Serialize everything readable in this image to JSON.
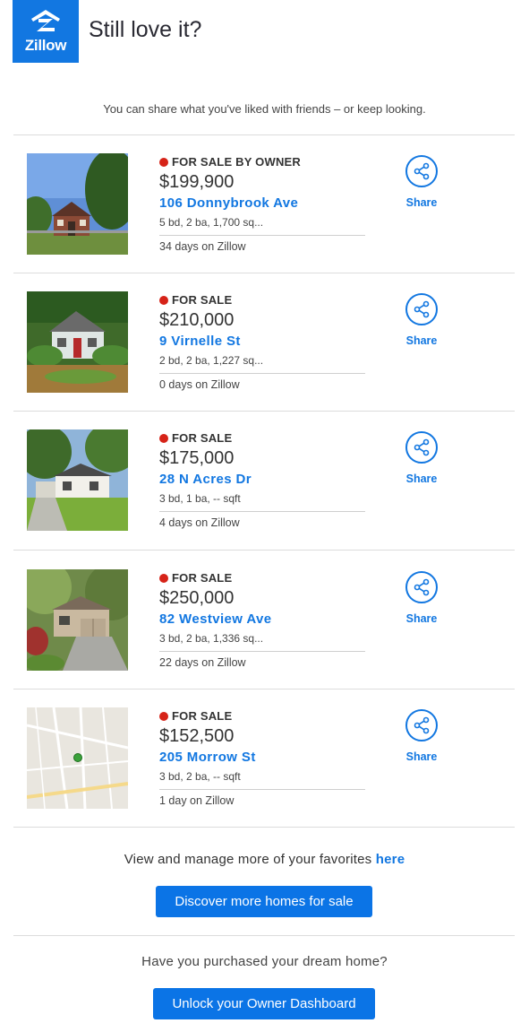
{
  "header": {
    "logo_text": "Zillow",
    "title": "Still love it?"
  },
  "subtitle": "You can share what you've liked with friends – or keep looking.",
  "listings": [
    {
      "status": "FOR SALE BY OWNER",
      "price": "$199,900",
      "address": "106 Donnybrook Ave",
      "facts": "5 bd, 2 ba, 1,700 sq...",
      "days": "34 days on Zillow",
      "share": "Share",
      "photo": "house-brick"
    },
    {
      "status": "FOR SALE",
      "price": "$210,000",
      "address": "9 Virnelle St",
      "facts": "2 bd, 2 ba, 1,227 sq...",
      "days": "0 days on Zillow",
      "share": "Share",
      "photo": "house-green"
    },
    {
      "status": "FOR SALE",
      "price": "$175,000",
      "address": "28 N Acres Dr",
      "facts": "3 bd, 1 ba, -- sqft",
      "days": "4 days on Zillow",
      "share": "Share",
      "photo": "house-white"
    },
    {
      "status": "FOR SALE",
      "price": "$250,000",
      "address": "82 Westview Ave",
      "facts": "3 bd, 2 ba, 1,336 sq...",
      "days": "22 days on Zillow",
      "share": "Share",
      "photo": "house-garage"
    },
    {
      "status": "FOR SALE",
      "price": "$152,500",
      "address": "205 Morrow St",
      "facts": "3 bd, 2 ba, -- sqft",
      "days": "1 day on Zillow",
      "share": "Share",
      "photo": "map"
    }
  ],
  "manage": {
    "text": "View and manage more of your favorites ",
    "link": "here"
  },
  "discover_button": "Discover more homes for sale",
  "dream_text": "Have you purchased your dream home?",
  "owner_button": "Unlock your Owner Dashboard",
  "colors": {
    "brand": "#1277e1",
    "status_dot": "#d62318",
    "button": "#0b74e6"
  }
}
